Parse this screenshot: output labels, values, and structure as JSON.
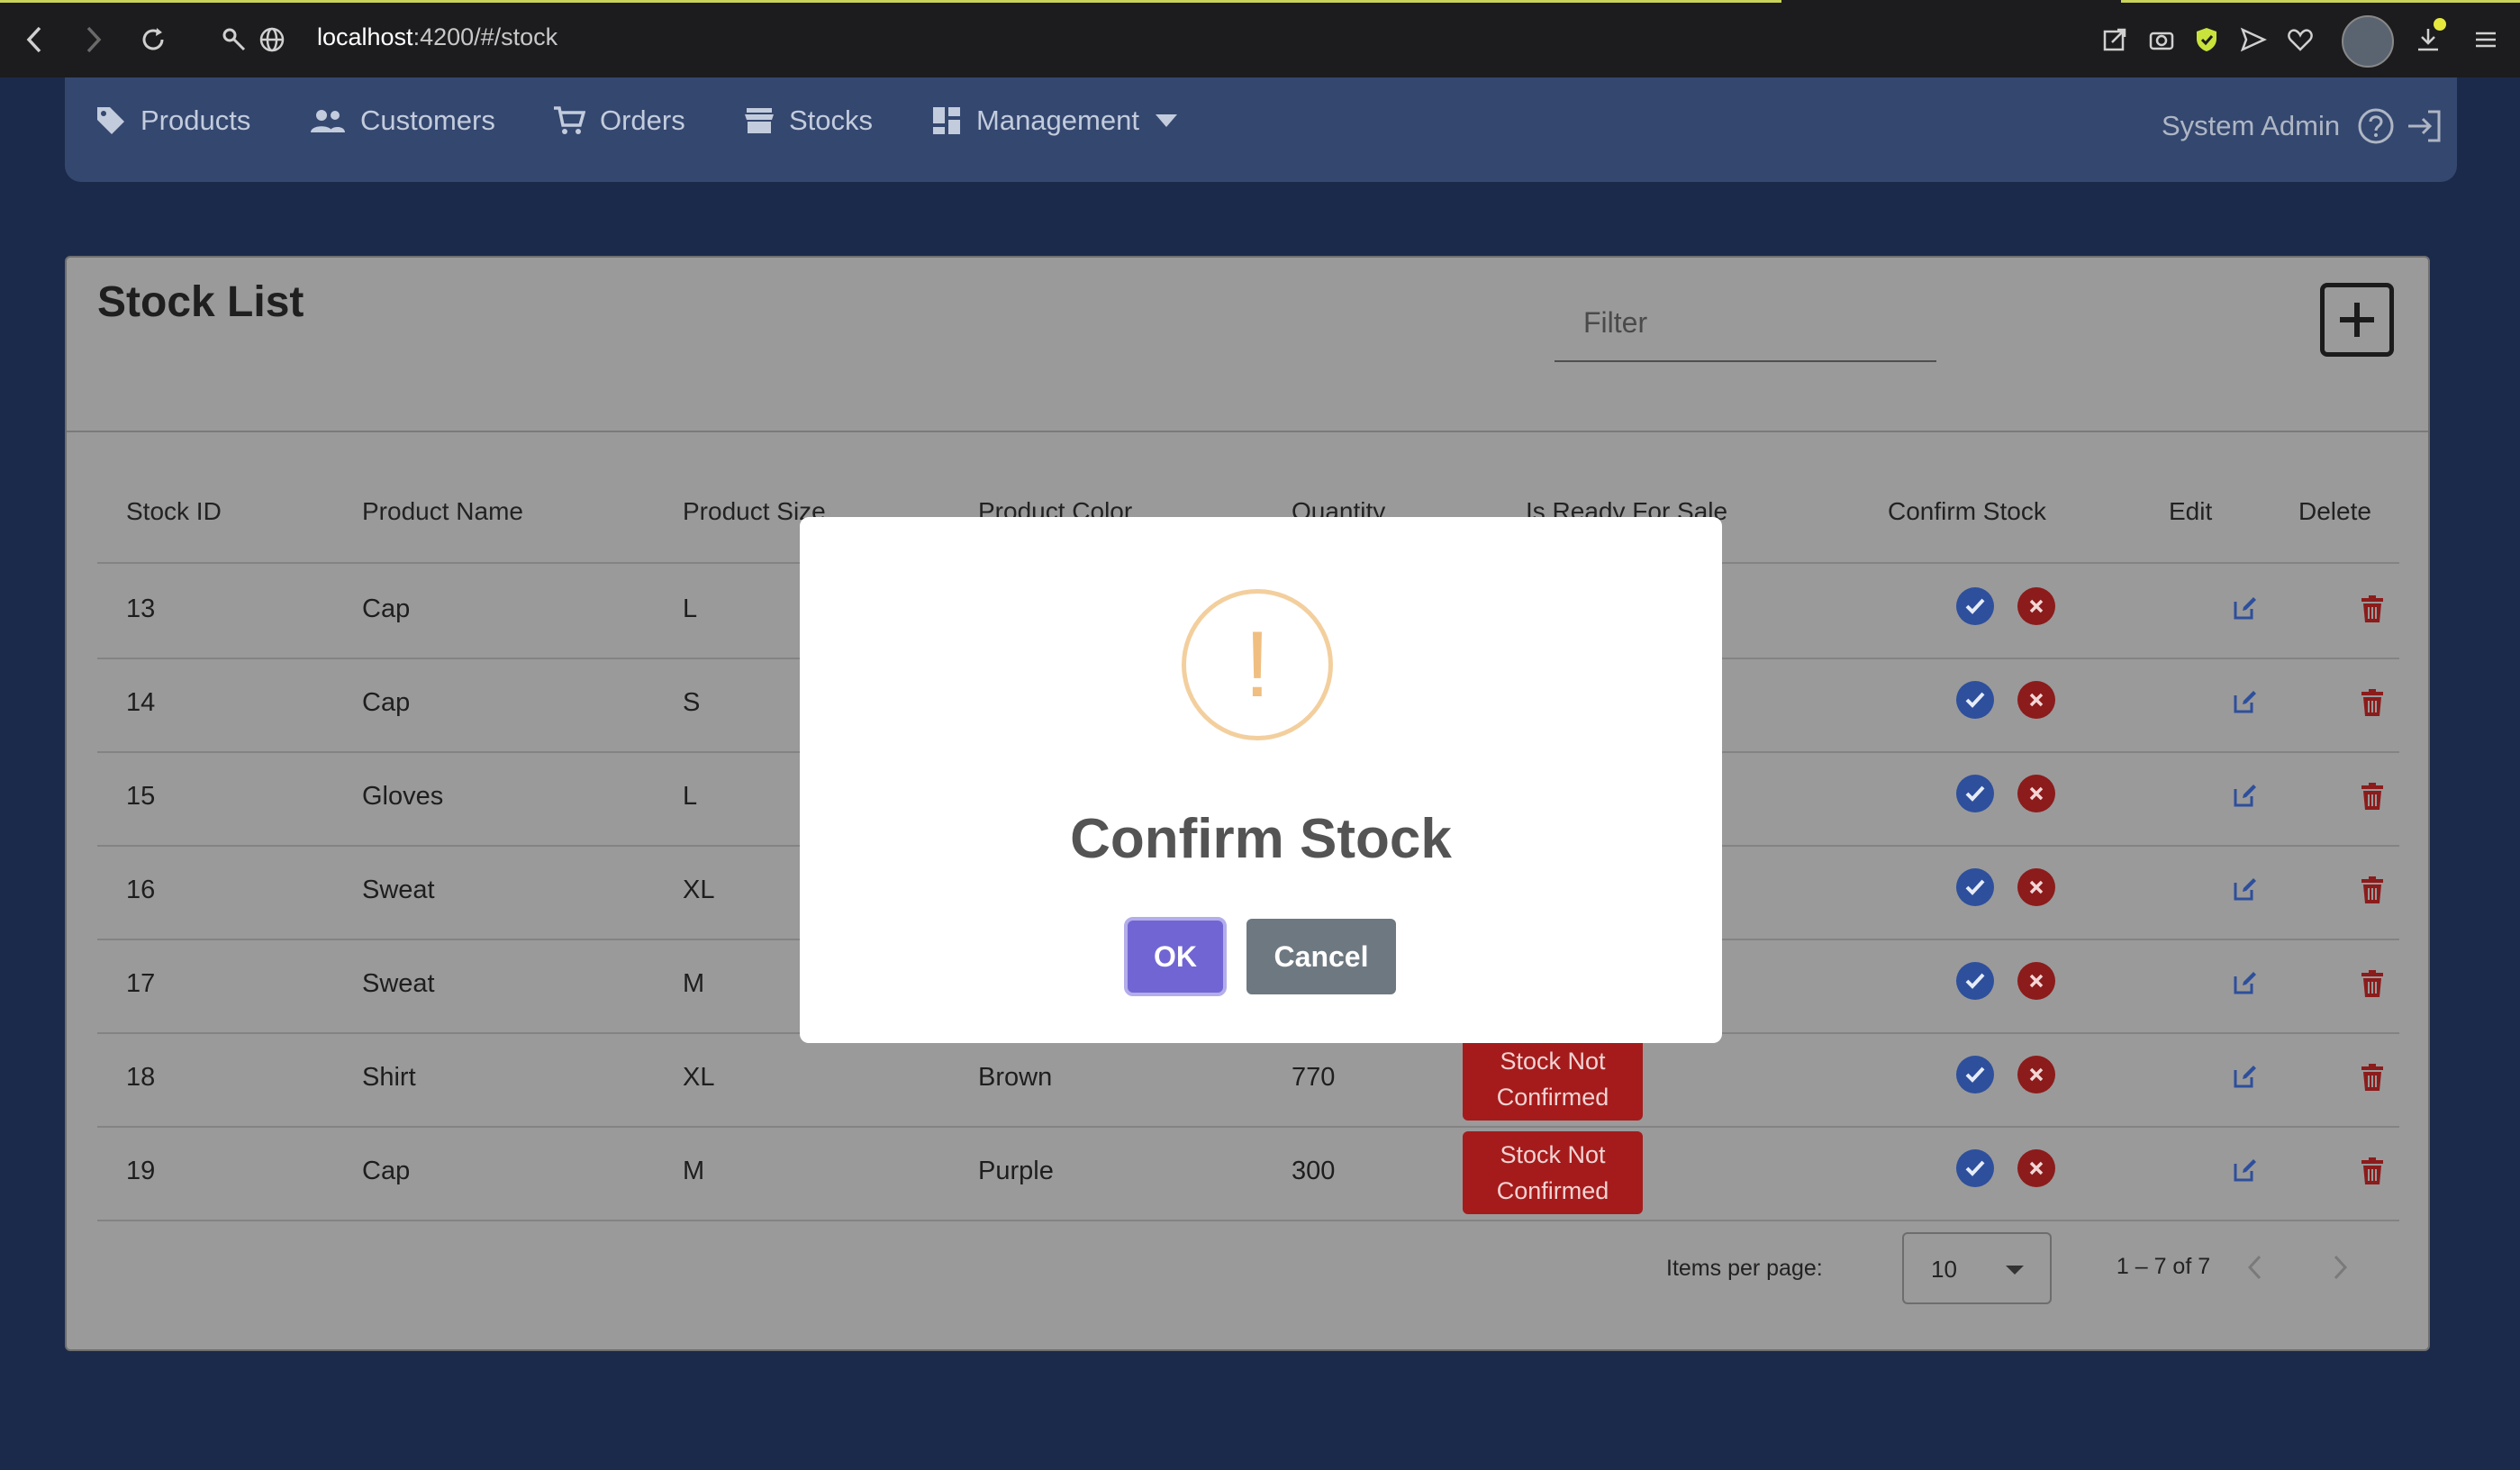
{
  "browser": {
    "url_host": "localhost",
    "url_path": ":4200/#/stock"
  },
  "nav": {
    "items": [
      {
        "label": "Products",
        "icon": "tag-icon"
      },
      {
        "label": "Customers",
        "icon": "users-icon"
      },
      {
        "label": "Orders",
        "icon": "cart-icon"
      },
      {
        "label": "Stocks",
        "icon": "store-icon"
      },
      {
        "label": "Management",
        "icon": "dashboard-icon"
      }
    ],
    "user": "System Admin"
  },
  "page": {
    "title": "Stock List",
    "filter_placeholder": "Filter"
  },
  "table": {
    "headers": [
      "Stock ID",
      "Product Name",
      "Product Size",
      "Product Color",
      "Quantity",
      "Is Ready For Sale",
      "Confirm Stock",
      "Edit",
      "Delete"
    ],
    "rows": [
      {
        "id": "13",
        "name": "Cap",
        "size": "L",
        "color": "",
        "qty": "",
        "status": ""
      },
      {
        "id": "14",
        "name": "Cap",
        "size": "S",
        "color": "",
        "qty": "",
        "status": ""
      },
      {
        "id": "15",
        "name": "Gloves",
        "size": "L",
        "color": "",
        "qty": "",
        "status": ""
      },
      {
        "id": "16",
        "name": "Sweat",
        "size": "XL",
        "color": "",
        "qty": "",
        "status": ""
      },
      {
        "id": "17",
        "name": "Sweat",
        "size": "M",
        "color": "",
        "qty": "",
        "status": ""
      },
      {
        "id": "18",
        "name": "Shirt",
        "size": "XL",
        "color": "Brown",
        "qty": "770",
        "status": "Stock Not Confirmed"
      },
      {
        "id": "19",
        "name": "Cap",
        "size": "M",
        "color": "Purple",
        "qty": "300",
        "status": "Stock Not Confirmed"
      }
    ]
  },
  "pager": {
    "label": "Items per page:",
    "page_size": "10",
    "range": "1 – 7 of 7"
  },
  "modal": {
    "icon": "!",
    "title": "Confirm Stock",
    "ok": "OK",
    "cancel": "Cancel"
  },
  "colors": {
    "accent": "#7165d4",
    "danger": "#a51b1b",
    "primary": "#2d4f9c"
  }
}
